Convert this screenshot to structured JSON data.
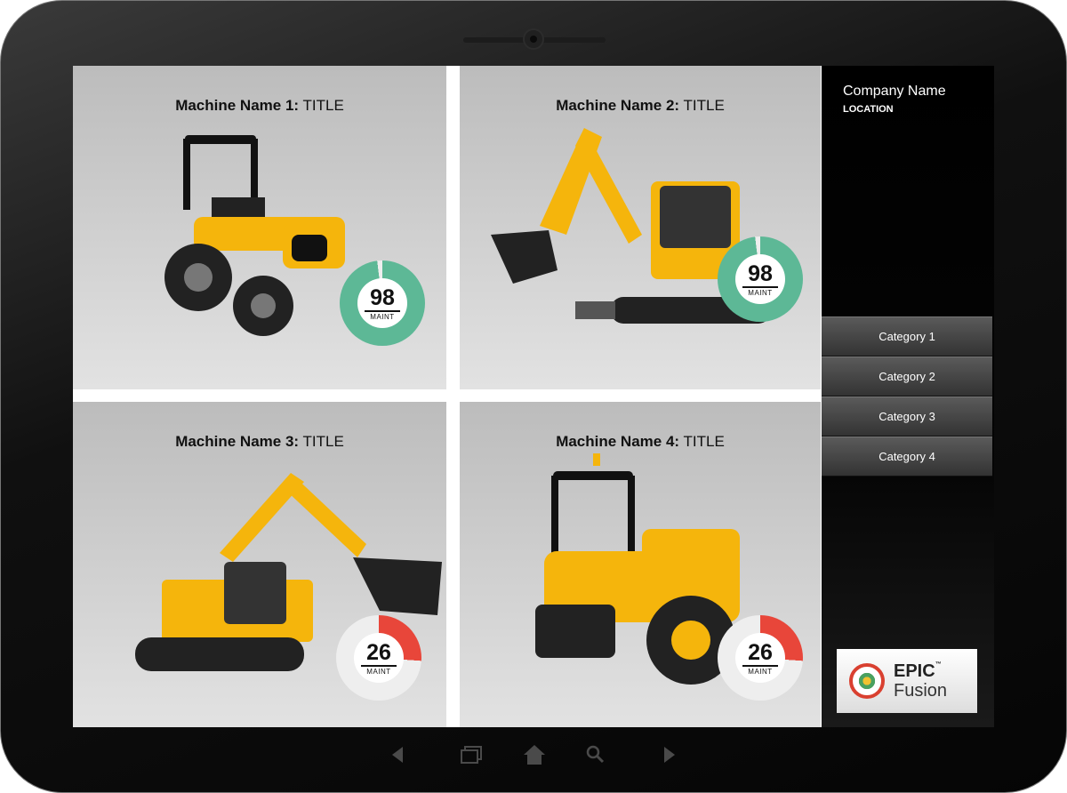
{
  "tiles": [
    {
      "name_label": "Machine Name 1:",
      "title": "TITLE",
      "value": "98",
      "unit": "MAINT",
      "percent": 98,
      "status": "good"
    },
    {
      "name_label": "Machine Name 2:",
      "title": "TITLE",
      "value": "98",
      "unit": "MAINT",
      "percent": 98,
      "status": "good"
    },
    {
      "name_label": "Machine Name 3:",
      "title": "TITLE",
      "value": "26",
      "unit": "MAINT",
      "percent": 26,
      "status": "bad"
    },
    {
      "name_label": "Machine Name 4:",
      "title": "TITLE",
      "value": "26",
      "unit": "MAINT",
      "percent": 26,
      "status": "bad"
    }
  ],
  "sidebar": {
    "company": "Company Name",
    "location": "LOCATION",
    "categories": [
      "Category 1",
      "Category 2",
      "Category 3",
      "Category 4"
    ]
  },
  "logo": {
    "epic": "EPIC",
    "tm": "™",
    "fusion": "Fusion"
  },
  "colors": {
    "good": "#5db896",
    "bad": "#e8463a",
    "machine": "#f5b50c"
  },
  "icons": {
    "back": "back-arrow-icon",
    "windows": "recent-apps-icon",
    "home": "home-icon",
    "search": "search-icon",
    "forward": "forward-arrow-icon"
  }
}
